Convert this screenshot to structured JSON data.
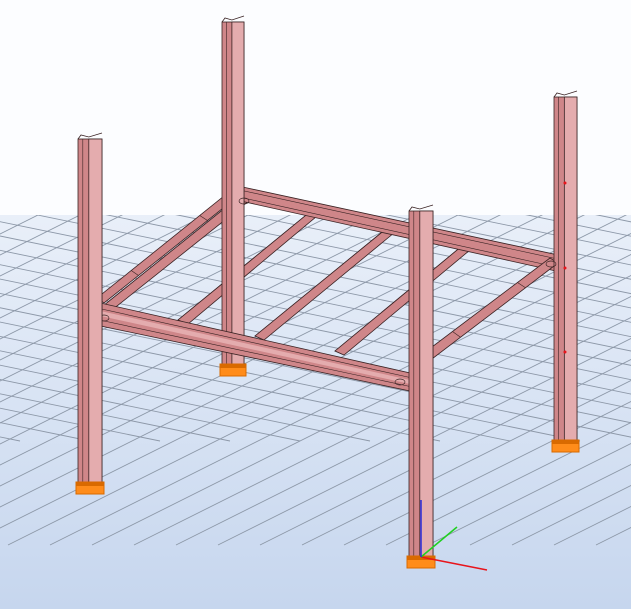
{
  "viewport": {
    "background_top": "#fcfdff",
    "background_bottom": "#c6d6ee",
    "grid_color": "#8d98a8"
  },
  "model": {
    "steel_color": "#cf8689",
    "steel_dark": "#9d5f62",
    "steel_light": "#e4acae",
    "edge_color": "#3a2324",
    "base_plate_color": "#ff8c1a",
    "base_plate_dark": "#d96a00",
    "columns": [
      "column-front-left",
      "column-back-left",
      "column-back-right",
      "column-front-right"
    ],
    "beams": [
      "beam-back",
      "beam-right",
      "beam-front",
      "beam-left"
    ],
    "joists": [
      "joist-1",
      "joist-2",
      "joist-3",
      "joist-4"
    ]
  },
  "axes": {
    "x_color": "#e8141b",
    "y_color": "#20d020",
    "z_color": "#2a2ad8"
  }
}
